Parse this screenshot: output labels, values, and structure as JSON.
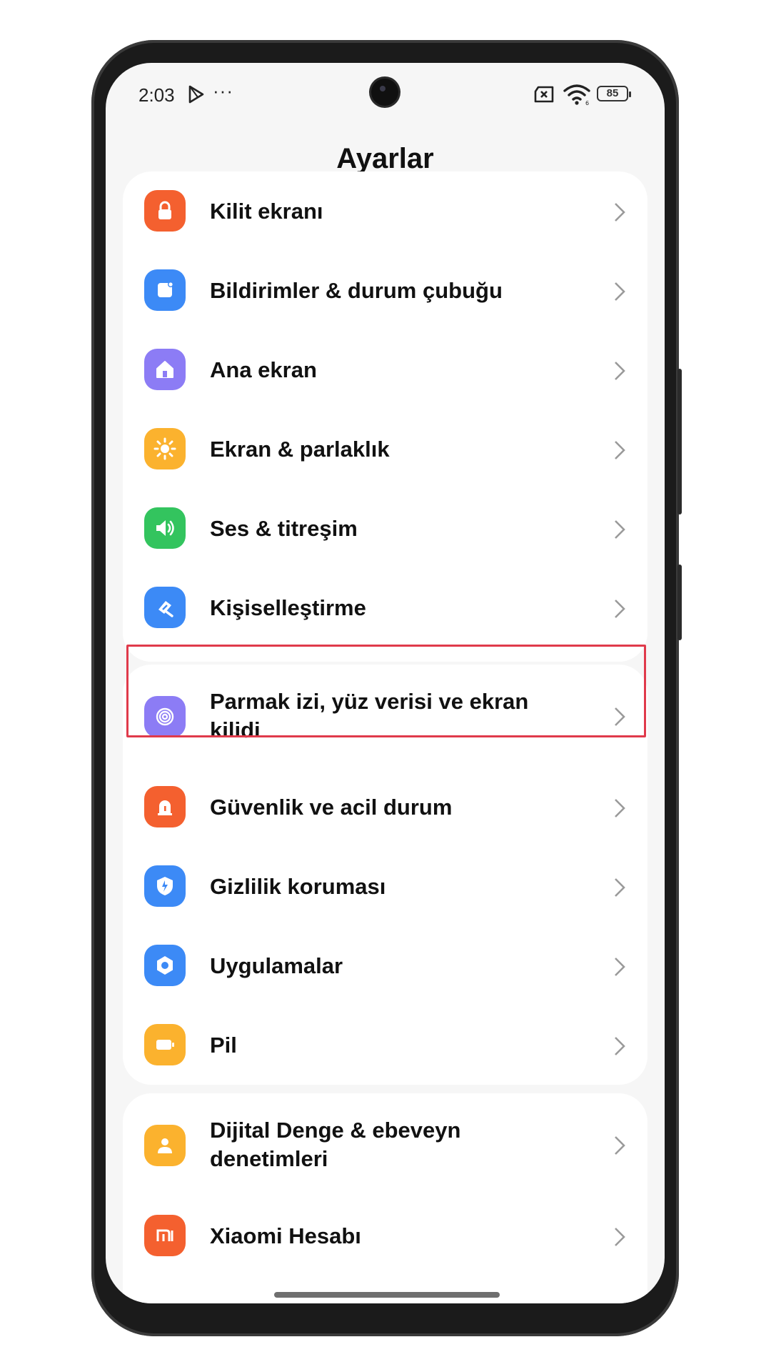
{
  "status_bar": {
    "time": "2:03",
    "dots": "···",
    "battery": "85"
  },
  "header": {
    "title": "Ayarlar"
  },
  "groups": [
    {
      "items": [
        {
          "label": "Kilit ekranı",
          "icon": "lock-icon",
          "color": "#F4602F"
        },
        {
          "label": "Bildirimler & durum çubuğu",
          "icon": "notification-icon",
          "color": "#3C8AF6"
        },
        {
          "label": "Ana ekran",
          "icon": "home-icon",
          "color": "#8C7CF5"
        },
        {
          "label": "Ekran & parlaklık",
          "icon": "sun-icon",
          "color": "#FBB22E"
        },
        {
          "label": "Ses & titreşim",
          "icon": "speaker-icon",
          "color": "#33C45E"
        },
        {
          "label": "Kişiselleştirme",
          "icon": "brush-icon",
          "color": "#3C8AF6"
        }
      ]
    },
    {
      "items": [
        {
          "label": "Parmak izi, yüz verisi ve ekran kilidi",
          "icon": "fingerprint-icon",
          "color": "#8C7CF5"
        },
        {
          "label": "Güvenlik ve acil durum",
          "icon": "emergency-icon",
          "color": "#F4602F"
        },
        {
          "label": "Gizlilik koruması",
          "icon": "privacy-icon",
          "color": "#3C8AF6"
        },
        {
          "label": "Uygulamalar",
          "icon": "apps-icon",
          "color": "#3C8AF6"
        },
        {
          "label": "Pil",
          "icon": "battery-icon",
          "color": "#FBB22E"
        }
      ]
    },
    {
      "items": [
        {
          "label": "Dijital Denge & ebeveyn denetimleri",
          "icon": "digital-wellbeing-icon",
          "color": "#FBB22E"
        },
        {
          "label": "Xiaomi Hesabı",
          "icon": "xiaomi-icon",
          "color": "#F4602F"
        }
      ]
    }
  ],
  "highlight_color": "#E03A4B"
}
